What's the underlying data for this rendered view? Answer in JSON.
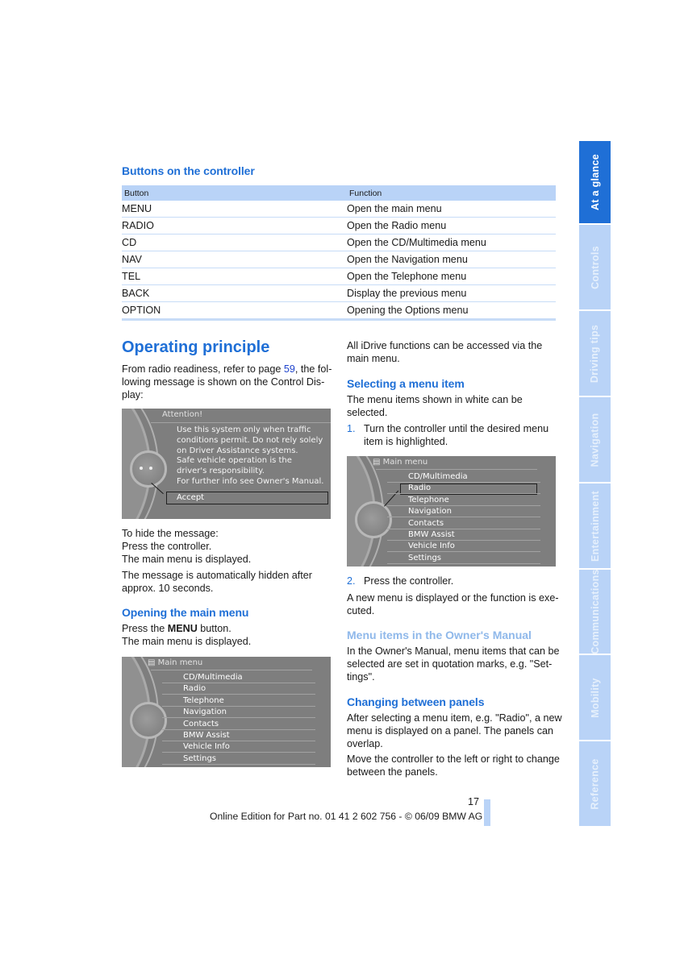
{
  "controller_section": {
    "heading": "Buttons on the controller",
    "table": {
      "headers": [
        "Button",
        "Function"
      ],
      "rows": [
        {
          "button": "MENU",
          "function": "Open the main menu"
        },
        {
          "button": "RADIO",
          "function": "Open the Radio menu"
        },
        {
          "button": "CD",
          "function": "Open the CD/Multimedia menu"
        },
        {
          "button": "NAV",
          "function": "Open the Navigation menu"
        },
        {
          "button": "TEL",
          "function": "Open the Telephone menu"
        },
        {
          "button": "BACK",
          "function": "Display the previous menu"
        },
        {
          "button": "OPTION",
          "function": "Opening the Options menu"
        }
      ]
    }
  },
  "operating": {
    "heading": "Operating principle",
    "intro_before_link": "From radio readiness, refer to page ",
    "intro_link": "59",
    "intro_after_link_1": ", the fol-",
    "intro_line2": "lowing message is shown on the Control Dis-",
    "intro_line3": "play:",
    "attention_screen": {
      "title": "Attention!",
      "lines": [
        "Use this system only when traffic",
        "conditions permit. Do not rely solely",
        "on Driver Assistance systems.",
        "Safe vehicle operation is the",
        "driver's responsibility.",
        "For further info see Owner's Manual."
      ],
      "accept_label": "Accept"
    },
    "hide_lines": [
      "To hide the message:",
      "Press the controller.",
      "The main menu is displayed."
    ],
    "auto_hide_line1": "The message is automatically hidden after",
    "auto_hide_line2": "approx. 10 seconds.",
    "open_menu_heading": "Opening the main menu",
    "press_prefix": "Press the ",
    "press_button": "MENU",
    "press_suffix": " button.",
    "press_result": "The main menu is displayed."
  },
  "main_menu_screen": {
    "title": "Main menu",
    "items": [
      "CD/Multimedia",
      "Radio",
      "Telephone",
      "Navigation",
      "Contacts",
      "BMW Assist",
      "Vehicle Info",
      "Settings"
    ],
    "highlighted": "Radio"
  },
  "right_column": {
    "intro_line1": "All iDrive functions can be accessed via the",
    "intro_line2": "main menu.",
    "select_heading": "Selecting a menu item",
    "select_line1": "The menu items shown in white can be",
    "select_line2": "selected.",
    "step1_num": "1.",
    "step1_line1": "Turn the controller until the desired menu",
    "step1_line2": "item is highlighted.",
    "step2_num": "2.",
    "step2_text": "Press the controller.",
    "result_line1": "A new menu is displayed or the function is exe-",
    "result_line2": "cuted.",
    "manual_heading": "Menu items in the Owner's Manual",
    "manual_line1": "In the Owner's Manual, menu items that can be",
    "manual_line2": "selected are set in quotation marks, e.g. \"Set-",
    "manual_line3": "tings\".",
    "panels_heading": "Changing between panels",
    "panels_line1": "After selecting a menu item, e.g. \"Radio\", a new",
    "panels_line2": "menu is displayed on a panel. The panels can",
    "panels_line3": "overlap.",
    "panels_line4": "Move the controller to the left or right to change",
    "panels_line5": "between the panels."
  },
  "side_tabs": [
    {
      "label": "At a glance",
      "active": true
    },
    {
      "label": "Controls",
      "active": false
    },
    {
      "label": "Driving tips",
      "active": false
    },
    {
      "label": "Navigation",
      "active": false
    },
    {
      "label": "Entertainment",
      "active": false
    },
    {
      "label": "Communications",
      "active": false
    },
    {
      "label": "Mobility",
      "active": false
    },
    {
      "label": "Reference",
      "active": false
    }
  ],
  "footer": {
    "page_number": "17",
    "edition": "Online Edition for Part no. 01 41 2 602 756 - © 06/09 BMW AG"
  },
  "colors": {
    "accent": "#1f6fd6",
    "tab_light": "#b9d3f7",
    "link": "#2044cc"
  }
}
